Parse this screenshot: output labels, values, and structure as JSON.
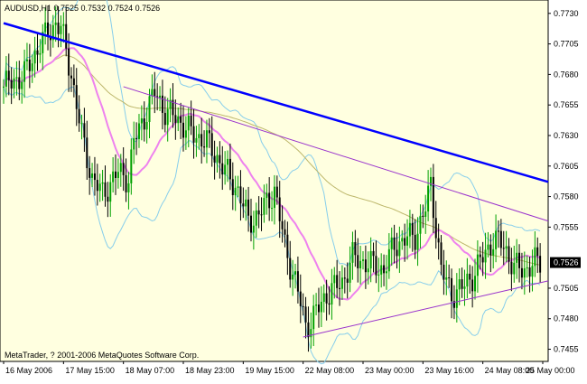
{
  "window": {
    "header": "AUDUSD,H1  0.7525 0.7532 0.7524 0.7526",
    "copyright": "MetaTrader, ? 2001-2006 MetaQuotes Software Corp.",
    "current_price_label": "0.7526"
  },
  "colors": {
    "background": "#FFFFE0",
    "frame": "#000000",
    "bull": "#00A000",
    "bear": "#000000",
    "bollinger": "#87CEEB",
    "ma_fast": "#EE82EE",
    "ma_slow": "#BDB76B",
    "trendline_blue": "#0000FF",
    "trendline_violet": "#9932CC",
    "price_label_bg": "#000000",
    "price_label_fg": "#FFFFFF"
  },
  "chart_data": {
    "type": "candlestick",
    "symbol": "AUDUSD",
    "timeframe": "H1",
    "ylim": [
      0.7448,
      0.7738
    ],
    "y_ticks": [
      "0.7730",
      "0.7705",
      "0.7680",
      "0.7655",
      "0.7630",
      "0.7605",
      "0.7580",
      "0.7555",
      "0.7526",
      "0.7505",
      "0.7480",
      "0.7455"
    ],
    "x_ticks": [
      "16 May 2006",
      "17 May 15:00",
      "18 May 07:00",
      "18 May 23:00",
      "19 May 15:00",
      "22 May 08:00",
      "23 May 00:00",
      "23 May 16:00",
      "24 May 08:00",
      "25 May 00:00"
    ],
    "last_price": 0.7526,
    "path_keypoints": [
      [
        0,
        0.767
      ],
      [
        8,
        0.768
      ],
      [
        14,
        0.7705
      ],
      [
        20,
        0.7722
      ],
      [
        22,
        0.7718
      ],
      [
        26,
        0.768
      ],
      [
        30,
        0.763
      ],
      [
        34,
        0.7595
      ],
      [
        38,
        0.7582
      ],
      [
        44,
        0.76
      ],
      [
        48,
        0.7595
      ],
      [
        50,
        0.7625
      ],
      [
        54,
        0.7645
      ],
      [
        58,
        0.7665
      ],
      [
        62,
        0.765
      ],
      [
        66,
        0.7645
      ],
      [
        72,
        0.7632
      ],
      [
        78,
        0.7625
      ],
      [
        84,
        0.7605
      ],
      [
        90,
        0.7585
      ],
      [
        94,
        0.756
      ],
      [
        98,
        0.7565
      ],
      [
        104,
        0.7585
      ],
      [
        108,
        0.754
      ],
      [
        112,
        0.751
      ],
      [
        116,
        0.7475
      ],
      [
        118,
        0.7478
      ],
      [
        124,
        0.75
      ],
      [
        130,
        0.751
      ],
      [
        134,
        0.753
      ],
      [
        140,
        0.7525
      ],
      [
        146,
        0.752
      ],
      [
        150,
        0.754
      ],
      [
        154,
        0.7545
      ],
      [
        158,
        0.7548
      ],
      [
        162,
        0.757
      ],
      [
        164,
        0.759
      ],
      [
        166,
        0.7555
      ],
      [
        168,
        0.752
      ],
      [
        172,
        0.75
      ],
      [
        176,
        0.7505
      ],
      [
        180,
        0.7515
      ],
      [
        184,
        0.753
      ],
      [
        188,
        0.7545
      ],
      [
        192,
        0.754
      ],
      [
        196,
        0.7522
      ],
      [
        200,
        0.752
      ],
      [
        204,
        0.7526
      ],
      [
        206,
        0.7526
      ]
    ],
    "trendlines": [
      {
        "name": "resistance-blue",
        "from": [
          "16 May 2006",
          0.7722
        ],
        "to": [
          "25 May 10:00",
          0.7592
        ]
      },
      {
        "name": "resistance-violet",
        "from": [
          "18 May 07:00",
          0.767
        ],
        "to": [
          "25 May 10:00",
          0.756
        ]
      },
      {
        "name": "support-violet",
        "from": [
          "22 May 08:00",
          0.7465
        ],
        "to": [
          "25 May 10:00",
          0.7511
        ]
      }
    ]
  }
}
